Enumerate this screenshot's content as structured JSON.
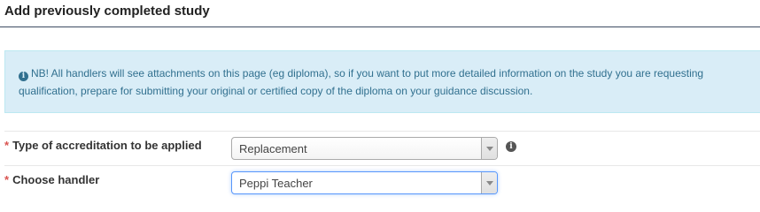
{
  "header": {
    "title": "Add previously completed study"
  },
  "notice": {
    "icon": "info-circle-icon",
    "line1": "NB! All handlers will see attachments on this page (eg diploma), so if you want to put more detailed information on the study you are requesting",
    "line2": "qualification, prepare for submitting your original or certified copy of the diploma on your guidance discussion."
  },
  "form": {
    "required_marker": "*",
    "accreditation": {
      "label": "Type of accreditation to be applied",
      "value": "Replacement",
      "help_icon": "info-circle-icon"
    },
    "handler": {
      "label": "Choose handler",
      "value": "Peppi Teacher"
    }
  },
  "colors": {
    "info_background": "#d9edf7",
    "info_text": "#31708f",
    "required": "#d9534f",
    "focus_border": "#5897fb"
  }
}
